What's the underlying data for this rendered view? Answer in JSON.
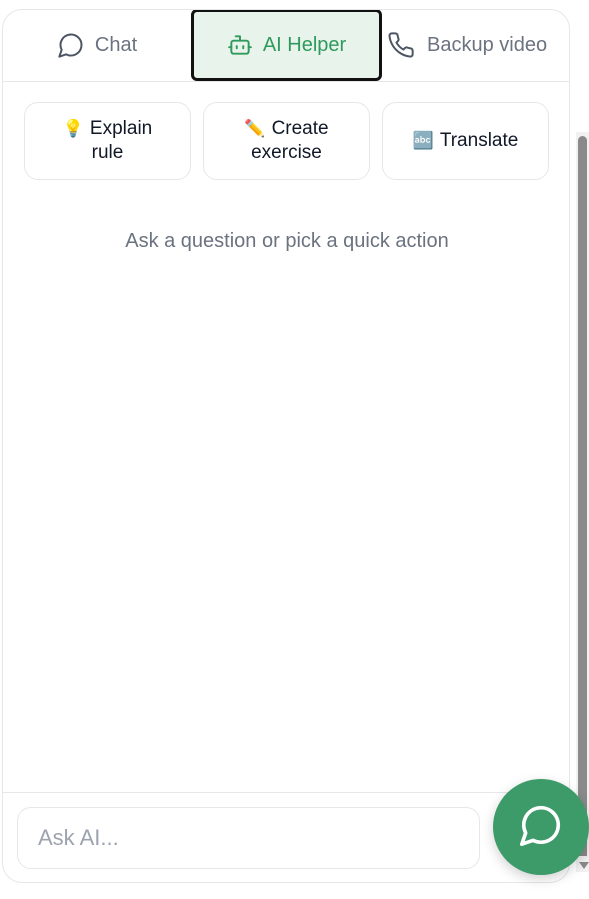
{
  "tabs": [
    {
      "label": "Chat",
      "icon": "chat-bubble-icon",
      "active": false
    },
    {
      "label": "AI Helper",
      "icon": "robot-icon",
      "active": true
    },
    {
      "label": "Backup video",
      "icon": "phone-icon",
      "active": false
    }
  ],
  "quick_actions": [
    {
      "emoji": "💡",
      "line1": "Explain",
      "line2": "rule",
      "icon": "lightbulb-icon"
    },
    {
      "emoji": "✏️",
      "line1": "Create",
      "line2": "exercise",
      "icon": "pencil-icon"
    },
    {
      "emoji": "🔤",
      "line1": "Translate",
      "line2": "",
      "icon": "abc-icon"
    }
  ],
  "empty_hint": "Ask a question or pick a quick action",
  "input": {
    "placeholder": "Ask AI...",
    "value": ""
  },
  "colors": {
    "accent": "#2f9a5c",
    "active_tab_bg": "#e8f3ec",
    "fab": "#3d9a69",
    "muted_text": "#6b7280",
    "border": "#e5e7eb"
  },
  "fab": {
    "icon": "chat-bubble-icon"
  }
}
